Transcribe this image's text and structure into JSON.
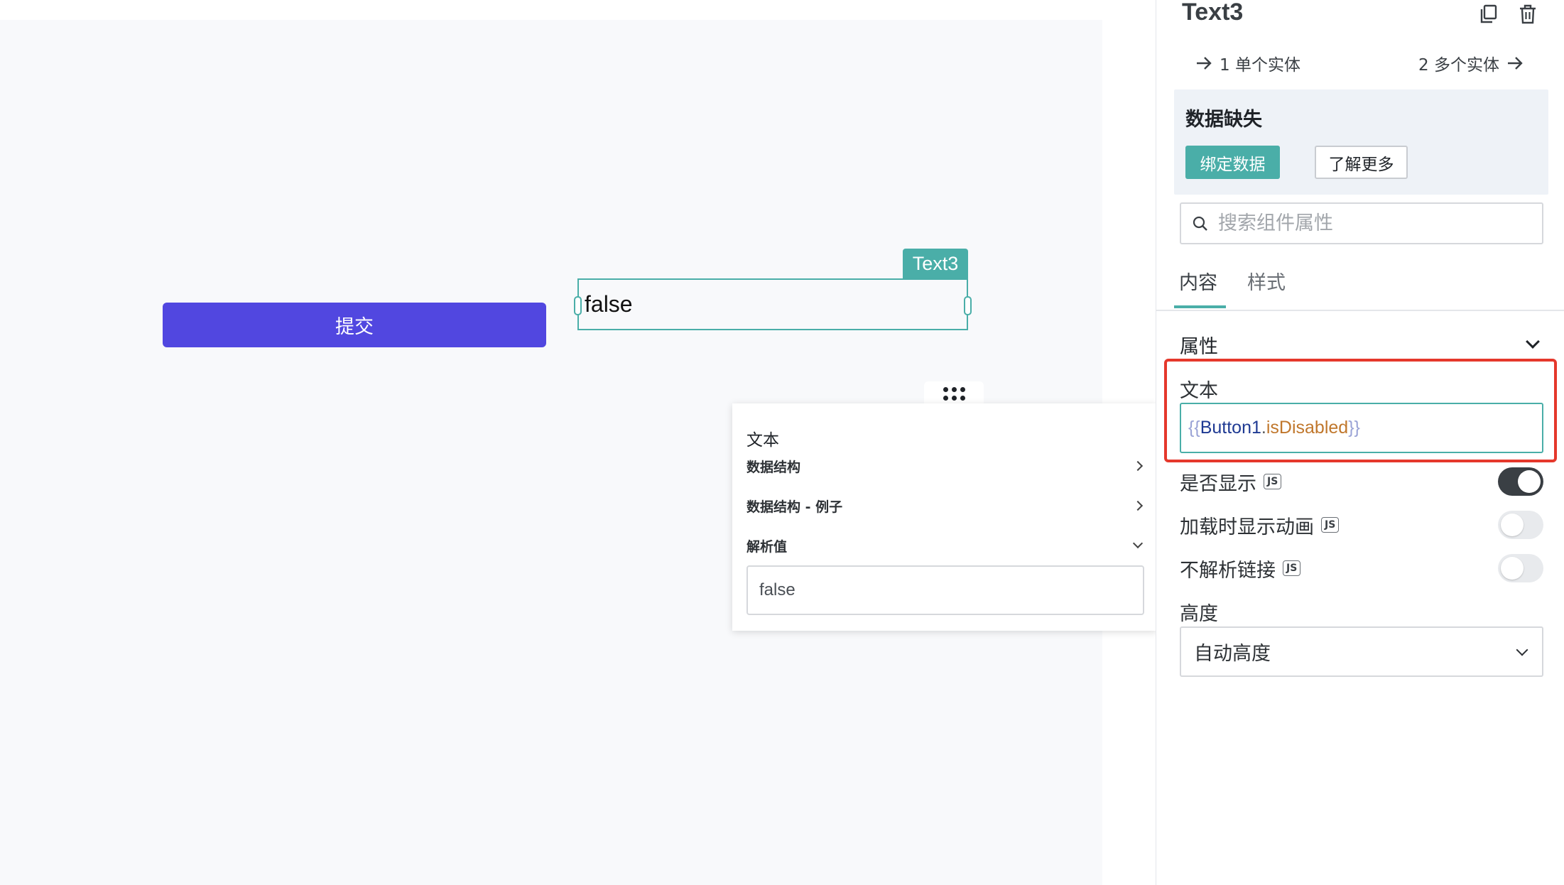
{
  "canvas": {
    "submit_button_label": "提交",
    "text_widget_value": "false",
    "widget_name_tag": "Text3"
  },
  "evaluated_popup": {
    "title": "文本",
    "rows": [
      {
        "label": "数据结构"
      },
      {
        "label": "数据结构 - 例子"
      },
      {
        "label": "解析值"
      }
    ],
    "evaluated_value": "false"
  },
  "property_pane": {
    "title": "Text3",
    "entity_links": {
      "single": "1 单个实体",
      "multiple": "2 多个实体"
    },
    "warning": {
      "title": "数据缺失",
      "bind_button": "绑定数据",
      "learn_more_button": "了解更多"
    },
    "search": {
      "placeholder": "搜索组件属性"
    },
    "tabs": {
      "content": "内容",
      "style": "样式"
    },
    "section": {
      "title": "属性"
    },
    "text_field": {
      "label": "文本",
      "brace_open": "{{",
      "object": "Button1",
      "dot": ".",
      "property": "isDisabled",
      "brace_close": "}}"
    },
    "toggles": {
      "visible": {
        "label": "是否显示",
        "badge": "JS",
        "on": true
      },
      "animate_loading": {
        "label": "加载时显示动画",
        "badge": "JS",
        "on": false
      },
      "disable_link": {
        "label": "不解析链接",
        "badge": "JS",
        "on": false
      }
    },
    "height": {
      "label": "高度",
      "selected": "自动高度"
    }
  },
  "colors": {
    "accent": "#4aaea8",
    "primary_button": "#5147e0",
    "highlight_border": "#e5382c"
  }
}
